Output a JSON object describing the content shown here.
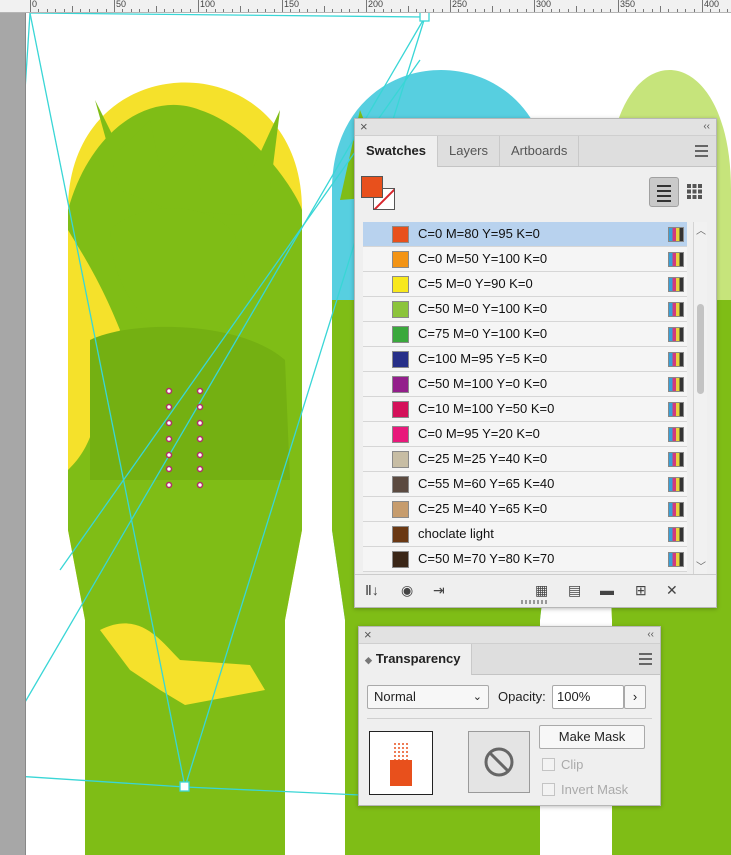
{
  "ruler": {
    "labels": [
      "0",
      "50",
      "100",
      "150",
      "200",
      "250",
      "300",
      "350",
      "400"
    ]
  },
  "colors": {
    "boardYellow": "#f5e12b",
    "boardGreen": "#7fbd16",
    "boardCyan": "#57cfe0",
    "boardLightGreen": "#c6e47b",
    "selection": "#39d6d6",
    "fill": "#e8501c"
  },
  "swatches": {
    "tabs": [
      "Swatches",
      "Layers",
      "Artboards"
    ],
    "rows": [
      {
        "name": "C=0 M=80 Y=95 K=0",
        "color": "#e8501c"
      },
      {
        "name": "C=0 M=50 Y=100 K=0",
        "color": "#f39415"
      },
      {
        "name": "C=5 M=0 Y=90 K=0",
        "color": "#f8e81c"
      },
      {
        "name": "C=50 M=0 Y=100 K=0",
        "color": "#8cc43c"
      },
      {
        "name": "C=75 M=0 Y=100 K=0",
        "color": "#3aa83c"
      },
      {
        "name": "C=100 M=95 Y=5 K=0",
        "color": "#272f88"
      },
      {
        "name": "C=50 M=100 Y=0 K=0",
        "color": "#931e8b"
      },
      {
        "name": "C=10 M=100 Y=50 K=0",
        "color": "#d4115a"
      },
      {
        "name": "C=0 M=95 Y=20 K=0",
        "color": "#e8197b"
      },
      {
        "name": "C=25 M=25 Y=40 K=0",
        "color": "#c7bda4"
      },
      {
        "name": "C=55 M=60 Y=65 K=40",
        "color": "#5b4a40"
      },
      {
        "name": "C=25 M=40 Y=65 K=0",
        "color": "#c69c6d"
      },
      {
        "name": "choclate light",
        "color": "#6a3813"
      },
      {
        "name": "C=50 M=70 Y=80 K=70",
        "color": "#3a2617"
      }
    ]
  },
  "transparency": {
    "title": "Transparency",
    "blend_mode": "Normal",
    "opacity_label": "Opacity:",
    "opacity_value": "100%",
    "make_mask": "Make Mask",
    "clip": "Clip",
    "invert_mask": "Invert Mask"
  }
}
